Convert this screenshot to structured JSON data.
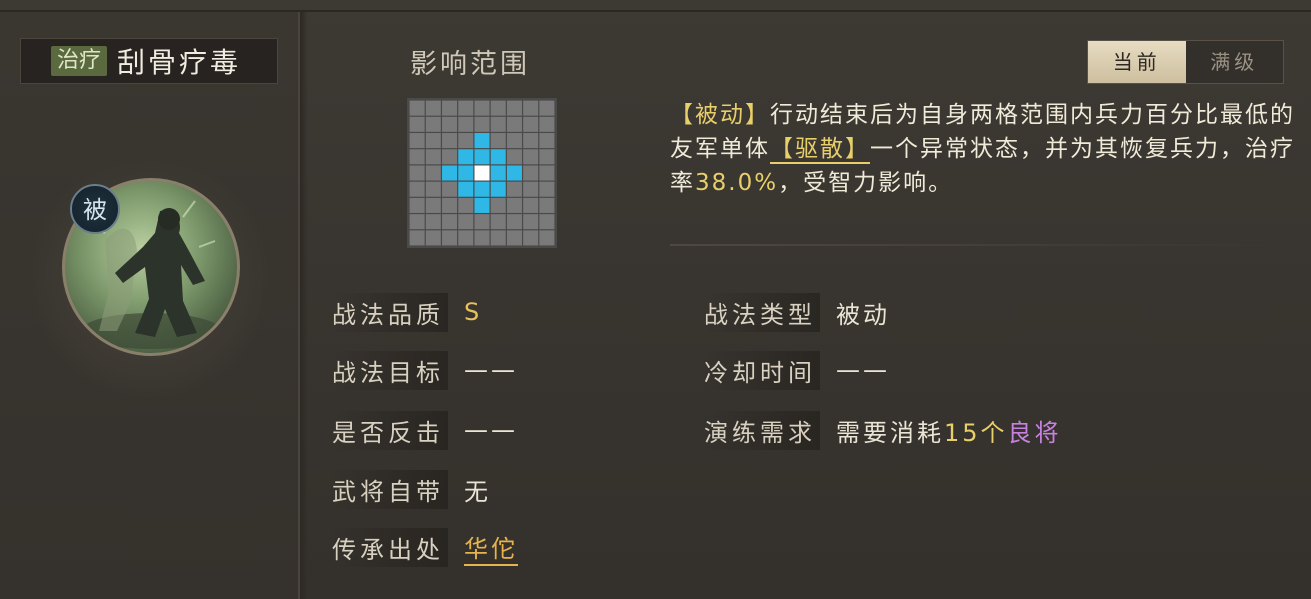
{
  "skill": {
    "type_badge": "治疗",
    "name": "刮骨疗毒",
    "passive_badge": "被"
  },
  "range": {
    "title": "影响范围",
    "grid_size": 9,
    "highlight_cells": [
      [
        3,
        4
      ],
      [
        4,
        3
      ],
      [
        4,
        5
      ],
      [
        5,
        4
      ],
      [
        2,
        4
      ],
      [
        4,
        2
      ],
      [
        4,
        6
      ],
      [
        6,
        4
      ],
      [
        3,
        3
      ],
      [
        3,
        5
      ],
      [
        5,
        3
      ],
      [
        5,
        5
      ]
    ],
    "center_cell": [
      4,
      4
    ],
    "colors": {
      "grid": "#7a7a7a",
      "line": "#4a4a4a",
      "highlight": "#2fb8e6",
      "center": "#ffffff"
    }
  },
  "tabs": {
    "current": "当前",
    "max": "满级"
  },
  "description": {
    "tag": "【被动】",
    "part1": "行动结束后为自身两格范围内兵力百分比最低的友军单体",
    "dispel": "【驱散】",
    "part2": "一个异常状态，并为其恢复兵力，治疗率",
    "rate": "38.0%",
    "part3": "，受智力影响。"
  },
  "attributes": {
    "quality_label": "战法品质",
    "quality_value": "S",
    "target_label": "战法目标",
    "target_value": "——",
    "counter_label": "是否反击",
    "counter_value": "——",
    "innate_label": "武将自带",
    "innate_value": "无",
    "inherit_label": "传承出处",
    "inherit_value": "华佗",
    "type_label": "战法类型",
    "type_value": "被动",
    "cooldown_label": "冷却时间",
    "cooldown_value": "——",
    "drill_label": "演练需求",
    "drill_prefix": "需要消耗",
    "drill_count": "15个",
    "drill_rarity": "良将"
  },
  "colors": {
    "accent_gold": "#e8cf6a",
    "rarity_purple": "#c782e0",
    "heal_badge": "#5b6a3e"
  }
}
